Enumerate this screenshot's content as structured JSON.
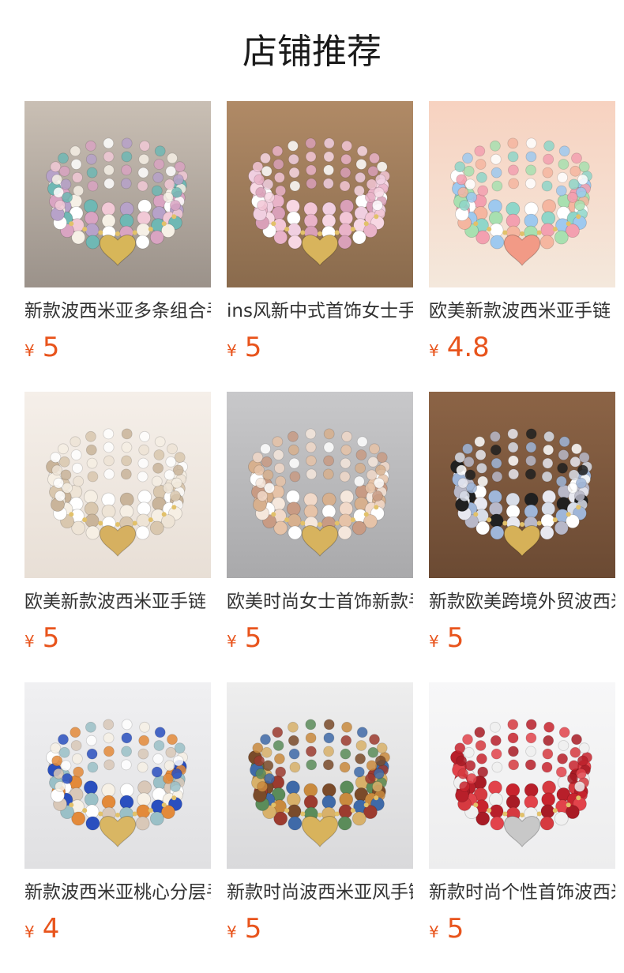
{
  "header": {
    "title": "店铺推荐"
  },
  "colors": {
    "price": "#e8541c",
    "title": "#1a1a1a",
    "name": "#333333"
  },
  "products": [
    {
      "name": "新款波西米亚多条组合手链",
      "currency": "¥",
      "price": "5",
      "image": {
        "icon": "bracelet-photo",
        "bg": "#9b928a",
        "bg2": "#c9bfb4",
        "beads": [
          "#f1c9d6",
          "#6fb8b4",
          "#f6f0e6",
          "#d9a4c2",
          "#ffffff",
          "#b7a2c9"
        ],
        "charm": "#d7b659"
      }
    },
    {
      "name": "ins风新中式首饰女士手链",
      "currency": "¥",
      "price": "5",
      "image": {
        "icon": "bracelet-photo",
        "bg": "#8a6b4d",
        "bg2": "#b08a66",
        "beads": [
          "#f3c6d6",
          "#f7d7e3",
          "#e9b3c8",
          "#ffffff",
          "#d9a0b8",
          "#f0cfe0"
        ],
        "charm": "#d8b45c"
      }
    },
    {
      "name": "欧美新款波西米亚手链",
      "currency": "¥",
      "price": "4.8",
      "image": {
        "icon": "bracelet-photo",
        "bg": "#f4e8dc",
        "bg2": "#f7d2c0",
        "beads": [
          "#8fd6c9",
          "#9ec9ef",
          "#f3a0b0",
          "#a8e0b0",
          "#f5b6a0",
          "#ffffff"
        ],
        "charm": "#f29a86"
      }
    },
    {
      "name": "欧美新款波西米亚手链",
      "currency": "¥",
      "price": "5",
      "image": {
        "icon": "bracelet-photo",
        "bg": "#e8dfd6",
        "bg2": "#f5efe9",
        "beads": [
          "#ffffff",
          "#f6efe4",
          "#eee4d6",
          "#d9c7ae",
          "#ffffff",
          "#c9b49a"
        ],
        "charm": "#d6b060"
      }
    },
    {
      "name": "欧美时尚女士首饰新款手链",
      "currency": "¥",
      "price": "5",
      "image": {
        "icon": "bracelet-photo",
        "bg": "#a9a9ab",
        "bg2": "#c8c8ca",
        "beads": [
          "#f1d9c9",
          "#ffffff",
          "#e6c3a8",
          "#c89b84",
          "#f5e7dc",
          "#d7b08e"
        ],
        "charm": "#d7b35e"
      }
    },
    {
      "name": "新款欧美跨境外贸波西米亚",
      "currency": "¥",
      "price": "5",
      "image": {
        "icon": "bracelet-photo",
        "bg": "#6b4a33",
        "bg2": "#8c6446",
        "beads": [
          "#d8dde8",
          "#9fb6d9",
          "#ffffff",
          "#b8b8c8",
          "#e8e8f0",
          "#202020"
        ],
        "charm": "#d6b158"
      }
    },
    {
      "name": "新款波西米亚桃心分层手链",
      "currency": "¥",
      "price": "4",
      "image": {
        "icon": "bracelet-photo",
        "bg": "#e0e0e2",
        "bg2": "#f0f0f2",
        "beads": [
          "#f7f1e6",
          "#2a4fbf",
          "#e38a3a",
          "#9ac0c7",
          "#d9c8b8",
          "#ffffff"
        ],
        "charm": "#d9b663"
      }
    },
    {
      "name": "新款时尚波西米亚风手链",
      "currency": "¥",
      "price": "5",
      "image": {
        "icon": "bracelet-photo",
        "bg": "#d9d9db",
        "bg2": "#eeeeee",
        "beads": [
          "#c98a3e",
          "#3f6aa8",
          "#9c3b2f",
          "#d8b16a",
          "#5b8c5a",
          "#7a4b2a"
        ],
        "charm": "#d8b35c"
      }
    },
    {
      "name": "新款时尚个性首饰波西米亚",
      "currency": "¥",
      "price": "5",
      "image": {
        "icon": "bracelet-photo",
        "bg": "#ededee",
        "bg2": "#f7f7f8",
        "beads": [
          "#c8242e",
          "#e2434b",
          "#a81b25",
          "#f0f0f0",
          "#d63a40",
          "#b81f2a"
        ],
        "charm": "#c8c8c8"
      }
    }
  ]
}
